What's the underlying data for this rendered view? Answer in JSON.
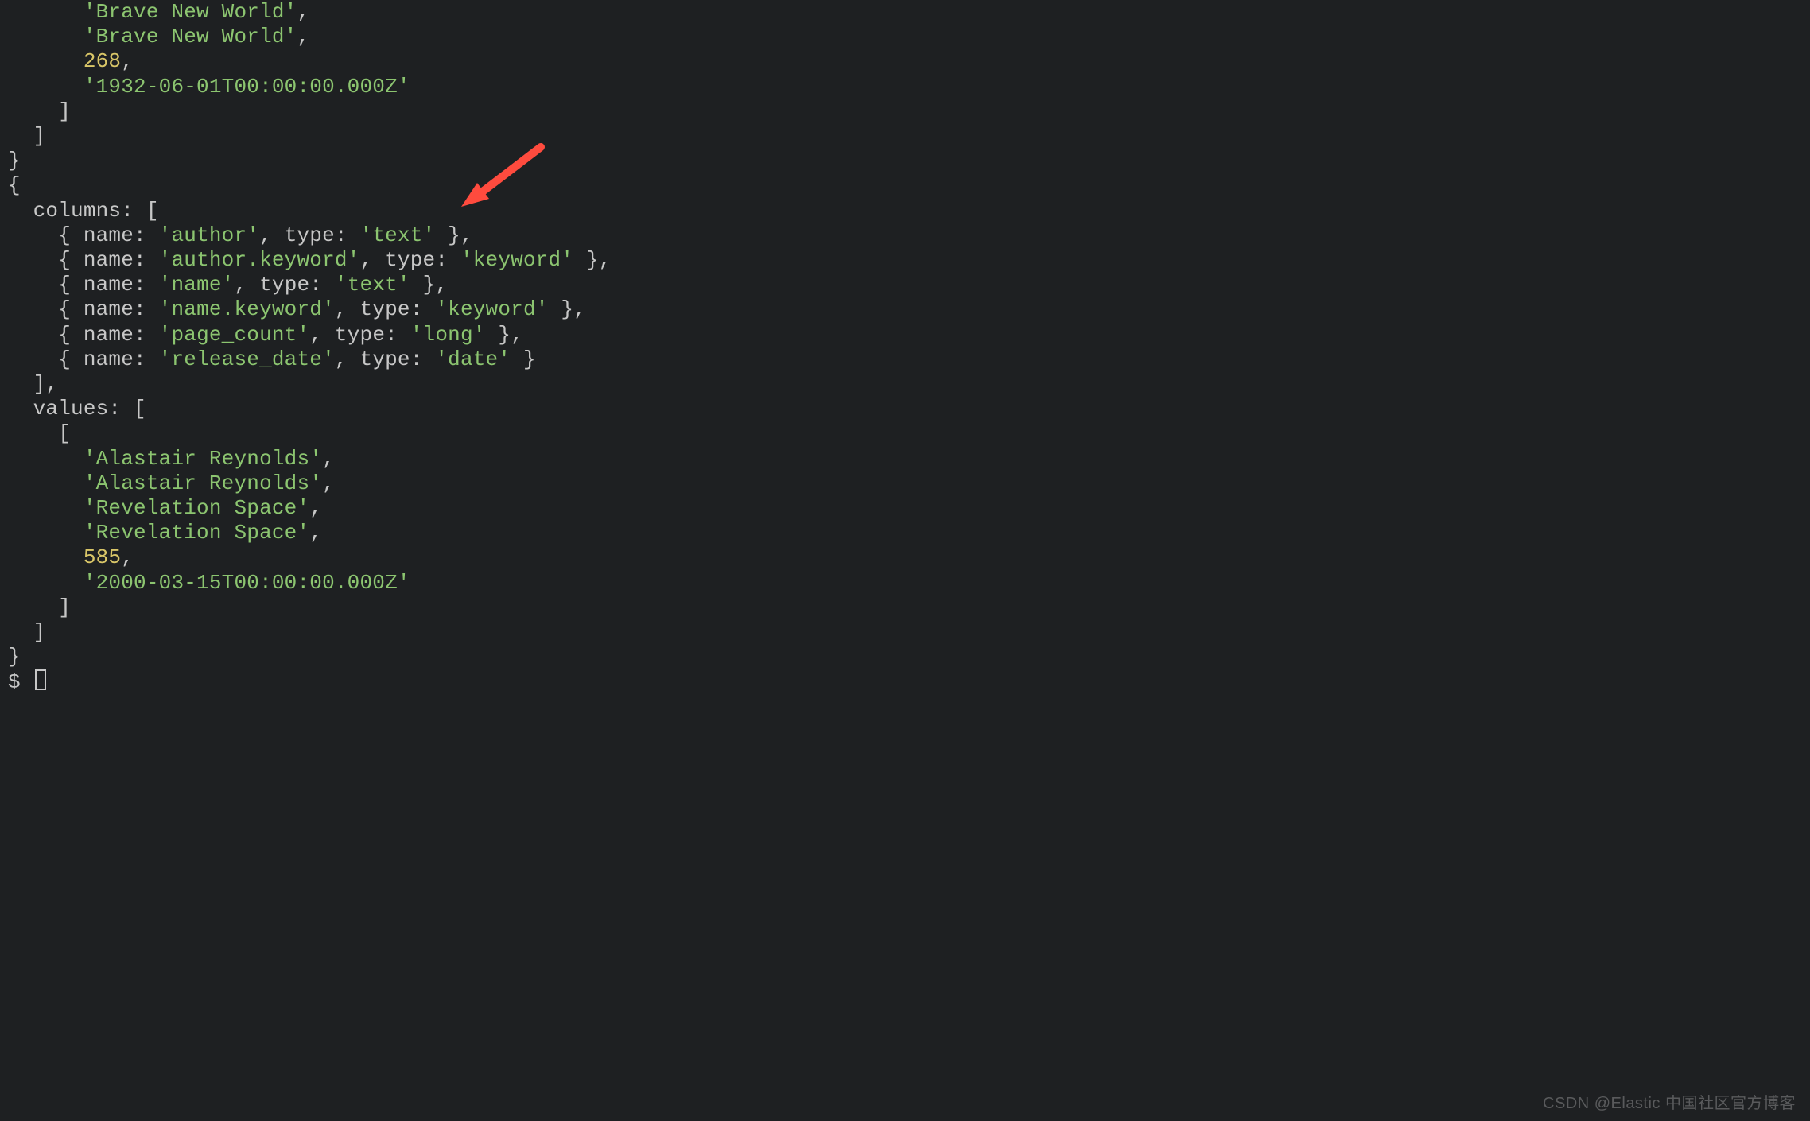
{
  "watermark": "CSDN @Elastic 中国社区官方博客",
  "prompt": "$",
  "obj1_tail": {
    "string_a": "'Brave New World'",
    "string_b": "'Brave New World'",
    "number": "268",
    "string_c": "'1932-06-01T00:00:00.000Z'"
  },
  "obj2": {
    "columns_key": "columns:",
    "name_key": "name:",
    "type_key": "type:",
    "values_key": "values:",
    "columns": [
      {
        "name": "'author'",
        "type": "'text'",
        "trail": ","
      },
      {
        "name": "'author.keyword'",
        "type": "'keyword'",
        "trail": ","
      },
      {
        "name": "'name'",
        "type": "'text'",
        "trail": ","
      },
      {
        "name": "'name.keyword'",
        "type": "'keyword'",
        "trail": ","
      },
      {
        "name": "'page_count'",
        "type": "'long'",
        "trail": ","
      },
      {
        "name": "'release_date'",
        "type": "'date'",
        "trail": ""
      }
    ],
    "values_row": {
      "a": "'Alastair Reynolds'",
      "b": "'Alastair Reynolds'",
      "c": "'Revelation Space'",
      "d": "'Revelation Space'",
      "n": "585",
      "e": "'2000-03-15T00:00:00.000Z'"
    }
  }
}
